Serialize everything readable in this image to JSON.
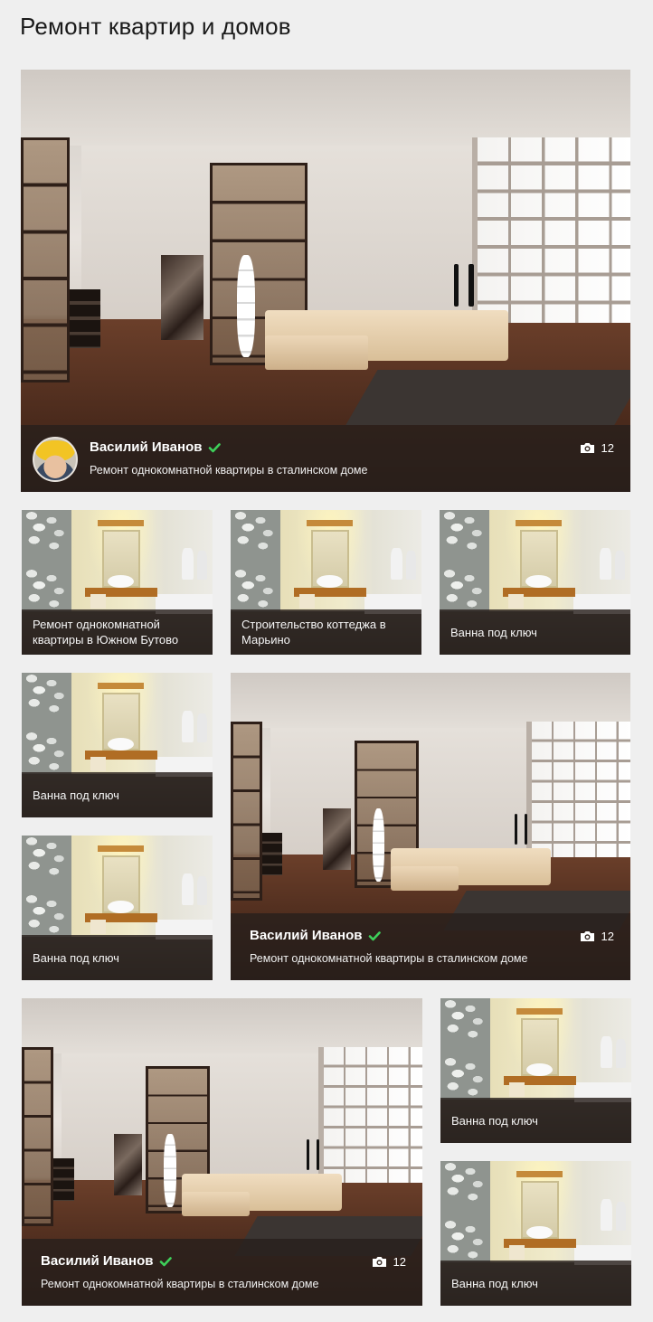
{
  "page": {
    "title": "Ремонт квартир и домов"
  },
  "cards": [
    {
      "id": "hero",
      "type": "large",
      "image": "living-room",
      "author": "Василий Иванов",
      "verified": true,
      "description": "Ремонт однокомнатной квартиры в сталинском доме",
      "photos": "12",
      "has_avatar": true
    },
    {
      "id": "b1",
      "type": "small",
      "image": "bathroom",
      "caption": "Ремонт однокомнатной квартиры в Южном Бутово"
    },
    {
      "id": "b2",
      "type": "small",
      "image": "bathroom",
      "caption": "Строительство коттеджа в Марьино"
    },
    {
      "id": "b3",
      "type": "small",
      "image": "bathroom",
      "caption": "Ванна под ключ"
    },
    {
      "id": "b4",
      "type": "small",
      "image": "bathroom",
      "caption": "Ванна под ключ"
    },
    {
      "id": "b5",
      "type": "small",
      "image": "bathroom",
      "caption": "Ванна под ключ"
    },
    {
      "id": "l2",
      "type": "large",
      "image": "living-room",
      "author": "Василий Иванов",
      "verified": true,
      "description": "Ремонт однокомнатной квартиры в сталинском доме",
      "photos": "12"
    },
    {
      "id": "l3",
      "type": "large",
      "image": "living-room",
      "author": "Василий Иванов",
      "verified": true,
      "description": "Ремонт однокомнатной квартиры в сталинском доме",
      "photos": "12"
    },
    {
      "id": "b6",
      "type": "small",
      "image": "bathroom",
      "caption": "Ванна под ключ"
    },
    {
      "id": "b7",
      "type": "small",
      "image": "bathroom",
      "caption": "Ванна под ключ"
    }
  ],
  "colors": {
    "background": "#efefef",
    "overlay": "rgba(40,32,28,0.82)",
    "verified": "#3ecf5a",
    "text": "#ffffff"
  },
  "icons": {
    "verified": "check-icon",
    "photos": "camera-icon"
  }
}
